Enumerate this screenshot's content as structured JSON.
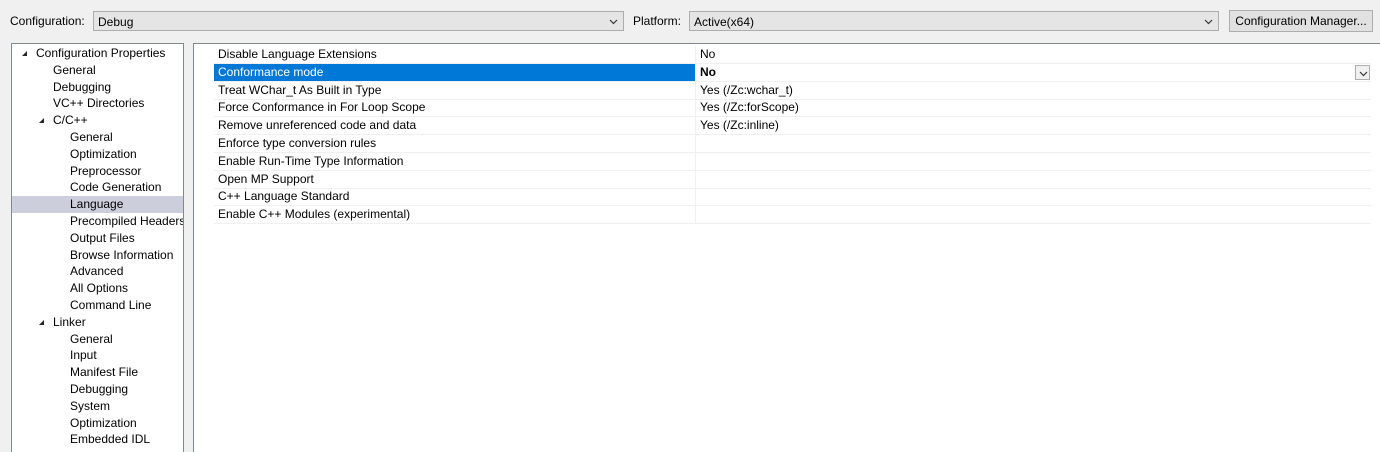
{
  "toolbar": {
    "configuration_label": "Configuration:",
    "configuration_value": "Debug",
    "platform_label": "Platform:",
    "platform_value": "Active(x64)",
    "config_manager_label": "Configuration Manager..."
  },
  "tree": {
    "items": [
      {
        "label": "Configuration Properties",
        "level": 0,
        "expanded": true
      },
      {
        "label": "General",
        "level": 1
      },
      {
        "label": "Debugging",
        "level": 1
      },
      {
        "label": "VC++ Directories",
        "level": 1
      },
      {
        "label": "C/C++",
        "level": 1,
        "expanded": true
      },
      {
        "label": "General",
        "level": 2
      },
      {
        "label": "Optimization",
        "level": 2
      },
      {
        "label": "Preprocessor",
        "level": 2
      },
      {
        "label": "Code Generation",
        "level": 2
      },
      {
        "label": "Language",
        "level": 2,
        "selected": true
      },
      {
        "label": "Precompiled Headers",
        "level": 2
      },
      {
        "label": "Output Files",
        "level": 2
      },
      {
        "label": "Browse Information",
        "level": 2
      },
      {
        "label": "Advanced",
        "level": 2
      },
      {
        "label": "All Options",
        "level": 2
      },
      {
        "label": "Command Line",
        "level": 2
      },
      {
        "label": "Linker",
        "level": 1,
        "expanded": true
      },
      {
        "label": "General",
        "level": 2
      },
      {
        "label": "Input",
        "level": 2
      },
      {
        "label": "Manifest File",
        "level": 2
      },
      {
        "label": "Debugging",
        "level": 2
      },
      {
        "label": "System",
        "level": 2
      },
      {
        "label": "Optimization",
        "level": 2
      },
      {
        "label": "Embedded IDL",
        "level": 2
      }
    ]
  },
  "grid": {
    "rows": [
      {
        "name": "Disable Language Extensions",
        "value": "No"
      },
      {
        "name": "Conformance mode",
        "value": "No",
        "selected": true
      },
      {
        "name": "Treat WChar_t As Built in Type",
        "value": "Yes (/Zc:wchar_t)"
      },
      {
        "name": "Force Conformance in For Loop Scope",
        "value": "Yes (/Zc:forScope)"
      },
      {
        "name": "Remove unreferenced code and data",
        "value": "Yes (/Zc:inline)"
      },
      {
        "name": "Enforce type conversion rules",
        "value": ""
      },
      {
        "name": "Enable Run-Time Type Information",
        "value": ""
      },
      {
        "name": "Open MP Support",
        "value": ""
      },
      {
        "name": "C++ Language Standard",
        "value": ""
      },
      {
        "name": "Enable C++ Modules (experimental)",
        "value": ""
      }
    ]
  },
  "colors": {
    "selection_blue": "#0078d7",
    "tree_selection": "#cccedb"
  },
  "icons": {
    "expander": "collapse-triangle-icon",
    "dropdown": "chevron-down-icon"
  }
}
